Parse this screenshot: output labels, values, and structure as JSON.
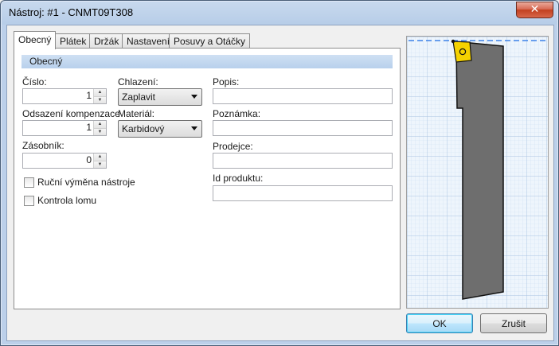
{
  "window": {
    "title": "Nástroj: #1 - CNMT09T308",
    "close_glyph": "✕"
  },
  "tabs": [
    {
      "label": "Obecný",
      "active": true
    },
    {
      "label": "Plátek",
      "active": false
    },
    {
      "label": "Držák",
      "active": false
    },
    {
      "label": "Nastavení",
      "active": false
    },
    {
      "label": "Posuvy a Otáčky",
      "active": false
    }
  ],
  "section": {
    "title": "Obecný"
  },
  "fields": {
    "cislo": {
      "label": "Číslo:",
      "value": "1"
    },
    "odsazeni": {
      "label": "Odsazení kompenzace",
      "value": "1"
    },
    "zasobnik": {
      "label": "Zásobník:",
      "value": "0"
    },
    "chlazeni": {
      "label": "Chlazení:",
      "value": "Zaplavit"
    },
    "material": {
      "label": "Materiál:",
      "value": "Karbidový"
    },
    "popis": {
      "label": "Popis:",
      "value": ""
    },
    "poznamka": {
      "label": "Poznámka:",
      "value": ""
    },
    "prodejce": {
      "label": "Prodejce:",
      "value": ""
    },
    "id_produktu": {
      "label": "Id produktu:",
      "value": ""
    }
  },
  "checkboxes": {
    "rucni_vymena": {
      "label": "Ruční výměna nástroje",
      "checked": false
    },
    "kontrola_lomu": {
      "label": "Kontrola lomu",
      "checked": false
    }
  },
  "buttons": {
    "ok": "OK",
    "cancel": "Zrušit"
  },
  "colors": {
    "insert": "#f5d200",
    "holder": "#6e6e6e",
    "grid_bg": "#eef5fc",
    "grid_line": "#b5cde6",
    "dashed_line": "#3b82e8"
  }
}
